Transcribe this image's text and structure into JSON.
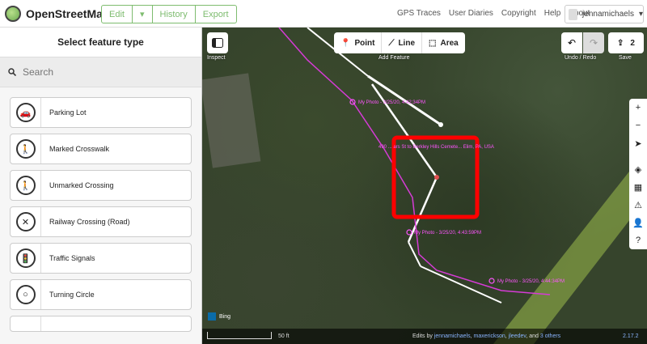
{
  "brand": {
    "name": "OpenStreetMap"
  },
  "nav": {
    "edit": "Edit",
    "history": "History",
    "export": "Export",
    "links": [
      "GPS Traces",
      "User Diaries",
      "Copyright",
      "Help",
      "About"
    ],
    "user": "jennamichaels"
  },
  "sidebar": {
    "title": "Select feature type",
    "search_placeholder": "Search",
    "presets": [
      {
        "label": "Parking Lot",
        "icon": "car-icon"
      },
      {
        "label": "Marked Crosswalk",
        "icon": "pedestrian-icon"
      },
      {
        "label": "Unmarked Crossing",
        "icon": "pedestrian-icon"
      },
      {
        "label": "Railway Crossing (Road)",
        "icon": "railway-cross-icon"
      },
      {
        "label": "Traffic Signals",
        "icon": "traffic-light-icon"
      },
      {
        "label": "Turning Circle",
        "icon": "circle-icon"
      }
    ]
  },
  "map": {
    "inspect_label": "Inspect",
    "modes": {
      "point": "Point",
      "line": "Line",
      "area": "Area",
      "caption": "Add Feature"
    },
    "undo_redo_caption": "Undo / Redo",
    "save_count": "2",
    "save_caption": "Save",
    "photo_labels": [
      "My Photo - 3/25/20, 4:42:34PM",
      "490 ... ars St to Berkley Hills Cemete... Elim, PA, USA",
      "My Photo - 3/25/20, 4:43:59PM",
      "My Photo - 3/25/20, 4:44:34PM"
    ],
    "imagery": "Bing",
    "scale": "50 ft",
    "attribution_prefix": "Edits by",
    "editors": [
      "jennamichaels",
      "maxerickson",
      "jleedev"
    ],
    "others": "3 others",
    "version": "2.17.2",
    "highlight_color": "#ff0000",
    "track_color": "#d63bd6"
  }
}
